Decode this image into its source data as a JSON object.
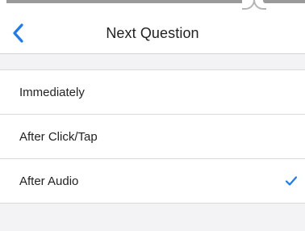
{
  "header": {
    "title": "Next Question",
    "back_icon": "chevron-left-icon"
  },
  "options": [
    {
      "label": "Immediately",
      "selected": false
    },
    {
      "label": "After Click/Tap",
      "selected": false
    },
    {
      "label": "After Audio",
      "selected": true
    }
  ],
  "colors": {
    "accent": "#1a7cf4",
    "background": "#f3f3f5",
    "row_background": "#ffffff",
    "separator": "#dadade",
    "text": "#222222"
  },
  "icons": {
    "selected": "checkmark-icon"
  }
}
